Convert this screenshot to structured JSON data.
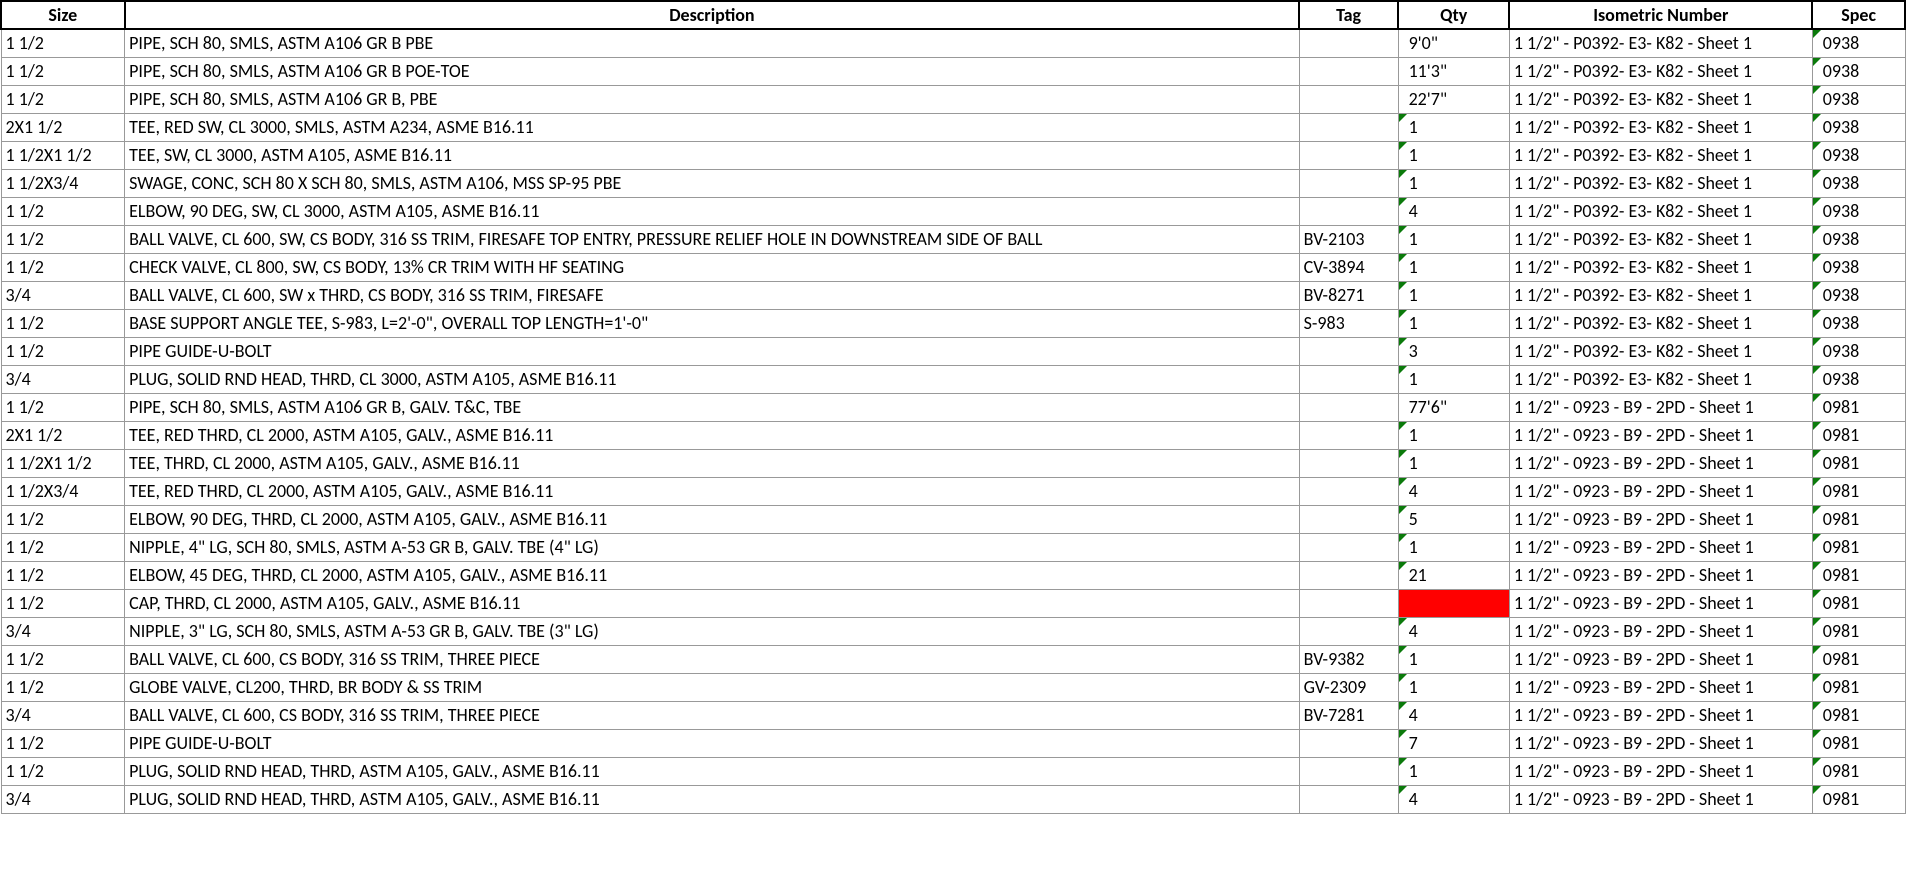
{
  "headers": {
    "size": "Size",
    "desc": "Description",
    "tag": "Tag",
    "qty": "Qty",
    "iso": "Isometric Number",
    "spec": "Spec"
  },
  "rows": [
    {
      "size": "1 1/2",
      "desc": "PIPE, SCH 80, SMLS, ASTM A106 GR B PBE",
      "tag": "",
      "qty": "9'0\"",
      "iso": "1 1/2\" - P0392- E3- K82 - Sheet 1",
      "spec": "0938",
      "qtyMark": false,
      "specMark": true,
      "red": false
    },
    {
      "size": "1 1/2",
      "desc": "PIPE, SCH 80, SMLS, ASTM A106 GR B POE-TOE",
      "tag": "",
      "qty": "11'3\"",
      "iso": "1 1/2\" - P0392- E3- K82 - Sheet 1",
      "spec": "0938",
      "qtyMark": false,
      "specMark": true,
      "red": false
    },
    {
      "size": "1 1/2",
      "desc": "PIPE, SCH 80, SMLS, ASTM A106 GR B, PBE",
      "tag": "",
      "qty": "22'7\"",
      "iso": "1 1/2\" - P0392- E3- K82 - Sheet 1",
      "spec": "0938",
      "qtyMark": false,
      "specMark": true,
      "red": false
    },
    {
      "size": "2X1 1/2",
      "desc": "TEE, RED SW, CL 3000, SMLS, ASTM A234, ASME B16.11",
      "tag": "",
      "qty": "1",
      "iso": "1 1/2\" - P0392- E3- K82 - Sheet 1",
      "spec": "0938",
      "qtyMark": true,
      "specMark": true,
      "red": false
    },
    {
      "size": "1 1/2X1 1/2",
      "desc": "TEE, SW, CL 3000, ASTM A105, ASME B16.11",
      "tag": "",
      "qty": "1",
      "iso": "1 1/2\" - P0392- E3- K82 - Sheet 1",
      "spec": "0938",
      "qtyMark": true,
      "specMark": true,
      "red": false
    },
    {
      "size": "1 1/2X3/4",
      "desc": "SWAGE, CONC, SCH 80 X SCH 80, SMLS, ASTM A106, MSS SP-95 PBE",
      "tag": "",
      "qty": "1",
      "iso": "1 1/2\" - P0392- E3- K82 - Sheet 1",
      "spec": "0938",
      "qtyMark": true,
      "specMark": true,
      "red": false
    },
    {
      "size": "1 1/2",
      "desc": "ELBOW, 90 DEG, SW, CL 3000, ASTM A105, ASME B16.11",
      "tag": "",
      "qty": "4",
      "iso": "1 1/2\" - P0392- E3- K82 - Sheet 1",
      "spec": "0938",
      "qtyMark": true,
      "specMark": true,
      "red": false
    },
    {
      "size": "1 1/2",
      "desc": "BALL VALVE, CL 600, SW, CS BODY, 316 SS TRIM, FIRESAFE TOP ENTRY, PRESSURE RELIEF HOLE IN DOWNSTREAM SIDE OF BALL",
      "tag": "BV-2103",
      "qty": "1",
      "iso": "1 1/2\" - P0392- E3- K82 - Sheet 1",
      "spec": "0938",
      "qtyMark": true,
      "specMark": true,
      "red": false
    },
    {
      "size": "1 1/2",
      "desc": "CHECK VALVE, CL 800, SW, CS BODY, 13% CR TRIM WITH HF SEATING",
      "tag": "CV-3894",
      "qty": "1",
      "iso": "1 1/2\" - P0392- E3- K82 - Sheet 1",
      "spec": "0938",
      "qtyMark": true,
      "specMark": true,
      "red": false
    },
    {
      "size": "3/4",
      "desc": "BALL VALVE, CL 600, SW x THRD, CS BODY, 316 SS TRIM, FIRESAFE",
      "tag": "BV-8271",
      "qty": "1",
      "iso": "1 1/2\" - P0392- E3- K82 - Sheet 1",
      "spec": "0938",
      "qtyMark": true,
      "specMark": true,
      "red": false
    },
    {
      "size": "1 1/2",
      "desc": "BASE SUPPORT ANGLE TEE, S-983, L=2'-0\", OVERALL TOP LENGTH=1'-0\"",
      "tag": "S-983",
      "qty": "1",
      "iso": "1 1/2\" - P0392- E3- K82 - Sheet 1",
      "spec": "0938",
      "qtyMark": true,
      "specMark": true,
      "red": false
    },
    {
      "size": "1 1/2",
      "desc": "PIPE GUIDE-U-BOLT",
      "tag": "",
      "qty": "3",
      "iso": "1 1/2\" - P0392- E3- K82 - Sheet 1",
      "spec": "0938",
      "qtyMark": true,
      "specMark": true,
      "red": false
    },
    {
      "size": "3/4",
      "desc": "PLUG, SOLID RND HEAD, THRD, CL 3000, ASTM A105, ASME B16.11",
      "tag": "",
      "qty": "1",
      "iso": "1 1/2\" - P0392- E3- K82 - Sheet 1",
      "spec": "0938",
      "qtyMark": true,
      "specMark": true,
      "red": false
    },
    {
      "size": "1 1/2",
      "desc": "PIPE, SCH 80, SMLS, ASTM A106 GR B, GALV. T&C, TBE",
      "tag": "",
      "qty": "77'6\"",
      "iso": "1 1/2\" - 0923 - B9 - 2PD - Sheet 1",
      "spec": "0981",
      "qtyMark": false,
      "specMark": true,
      "red": false
    },
    {
      "size": "2X1 1/2",
      "desc": "TEE, RED THRD, CL 2000, ASTM A105, GALV., ASME B16.11",
      "tag": "",
      "qty": "1",
      "iso": "1 1/2\" - 0923 - B9 - 2PD - Sheet 1",
      "spec": "0981",
      "qtyMark": true,
      "specMark": true,
      "red": false
    },
    {
      "size": "1 1/2X1 1/2",
      "desc": "TEE, THRD, CL 2000, ASTM A105, GALV., ASME B16.11",
      "tag": "",
      "qty": "1",
      "iso": "1 1/2\" - 0923 - B9 - 2PD - Sheet 1",
      "spec": "0981",
      "qtyMark": true,
      "specMark": true,
      "red": false
    },
    {
      "size": "1 1/2X3/4",
      "desc": "TEE, RED THRD, CL 2000, ASTM A105, GALV., ASME B16.11",
      "tag": "",
      "qty": "4",
      "iso": "1 1/2\" - 0923 - B9 - 2PD - Sheet 1",
      "spec": "0981",
      "qtyMark": true,
      "specMark": true,
      "red": false
    },
    {
      "size": "1 1/2",
      "desc": "ELBOW, 90 DEG, THRD, CL 2000, ASTM A105, GALV., ASME B16.11",
      "tag": "",
      "qty": "5",
      "iso": "1 1/2\" - 0923 - B9 - 2PD - Sheet 1",
      "spec": "0981",
      "qtyMark": true,
      "specMark": true,
      "red": false
    },
    {
      "size": "1 1/2",
      "desc": "NIPPLE, 4\" LG, SCH 80, SMLS, ASTM A-53 GR B, GALV. TBE (4\" LG)",
      "tag": "",
      "qty": "1",
      "iso": "1 1/2\" - 0923 - B9 - 2PD - Sheet 1",
      "spec": "0981",
      "qtyMark": true,
      "specMark": true,
      "red": false
    },
    {
      "size": "1 1/2",
      "desc": "ELBOW, 45 DEG, THRD, CL 2000, ASTM A105, GALV., ASME B16.11",
      "tag": "",
      "qty": "21",
      "iso": "1 1/2\" - 0923 - B9 - 2PD - Sheet 1",
      "spec": "0981",
      "qtyMark": true,
      "specMark": true,
      "red": false
    },
    {
      "size": "1 1/2",
      "desc": "CAP, THRD, CL 2000, ASTM A105, GALV., ASME B16.11",
      "tag": "",
      "qty": "",
      "iso": "1 1/2\" - 0923 - B9 - 2PD - Sheet 1",
      "spec": "0981",
      "qtyMark": false,
      "specMark": true,
      "red": true
    },
    {
      "size": "3/4",
      "desc": "NIPPLE, 3\" LG, SCH 80, SMLS, ASTM A-53 GR B, GALV. TBE (3\" LG)",
      "tag": "",
      "qty": "4",
      "iso": "1 1/2\" - 0923 - B9 - 2PD - Sheet 1",
      "spec": "0981",
      "qtyMark": true,
      "specMark": true,
      "red": false
    },
    {
      "size": "1 1/2",
      "desc": "BALL VALVE, CL 600, CS BODY, 316 SS TRIM, THREE PIECE",
      "tag": "BV-9382",
      "qty": "1",
      "iso": "1 1/2\" - 0923 - B9 - 2PD - Sheet 1",
      "spec": "0981",
      "qtyMark": true,
      "specMark": true,
      "red": false
    },
    {
      "size": "1 1/2",
      "desc": "GLOBE VALVE, CL200, THRD, BR BODY & SS TRIM",
      "tag": "GV-2309",
      "qty": "1",
      "iso": "1 1/2\" - 0923 - B9 - 2PD - Sheet 1",
      "spec": "0981",
      "qtyMark": true,
      "specMark": true,
      "red": false
    },
    {
      "size": "3/4",
      "desc": "BALL VALVE, CL 600, CS BODY, 316 SS TRIM, THREE PIECE",
      "tag": "BV-7281",
      "qty": "4",
      "iso": "1 1/2\" - 0923 - B9 - 2PD - Sheet 1",
      "spec": "0981",
      "qtyMark": true,
      "specMark": true,
      "red": false
    },
    {
      "size": "1 1/2",
      "desc": "PIPE GUIDE-U-BOLT",
      "tag": "",
      "qty": "7",
      "iso": "1 1/2\" - 0923 - B9 - 2PD - Sheet 1",
      "spec": "0981",
      "qtyMark": true,
      "specMark": true,
      "red": false
    },
    {
      "size": "1 1/2",
      "desc": "PLUG, SOLID RND HEAD, THRD, ASTM A105, GALV., ASME B16.11",
      "tag": "",
      "qty": "1",
      "iso": "1 1/2\" - 0923 - B9 - 2PD - Sheet 1",
      "spec": "0981",
      "qtyMark": true,
      "specMark": true,
      "red": false
    },
    {
      "size": "3/4",
      "desc": "PLUG, SOLID RND HEAD, THRD, ASTM A105, GALV., ASME B16.11",
      "tag": "",
      "qty": "4",
      "iso": "1 1/2\" - 0923 - B9 - 2PD - Sheet 1",
      "spec": "0981",
      "qtyMark": true,
      "specMark": true,
      "red": false
    }
  ]
}
